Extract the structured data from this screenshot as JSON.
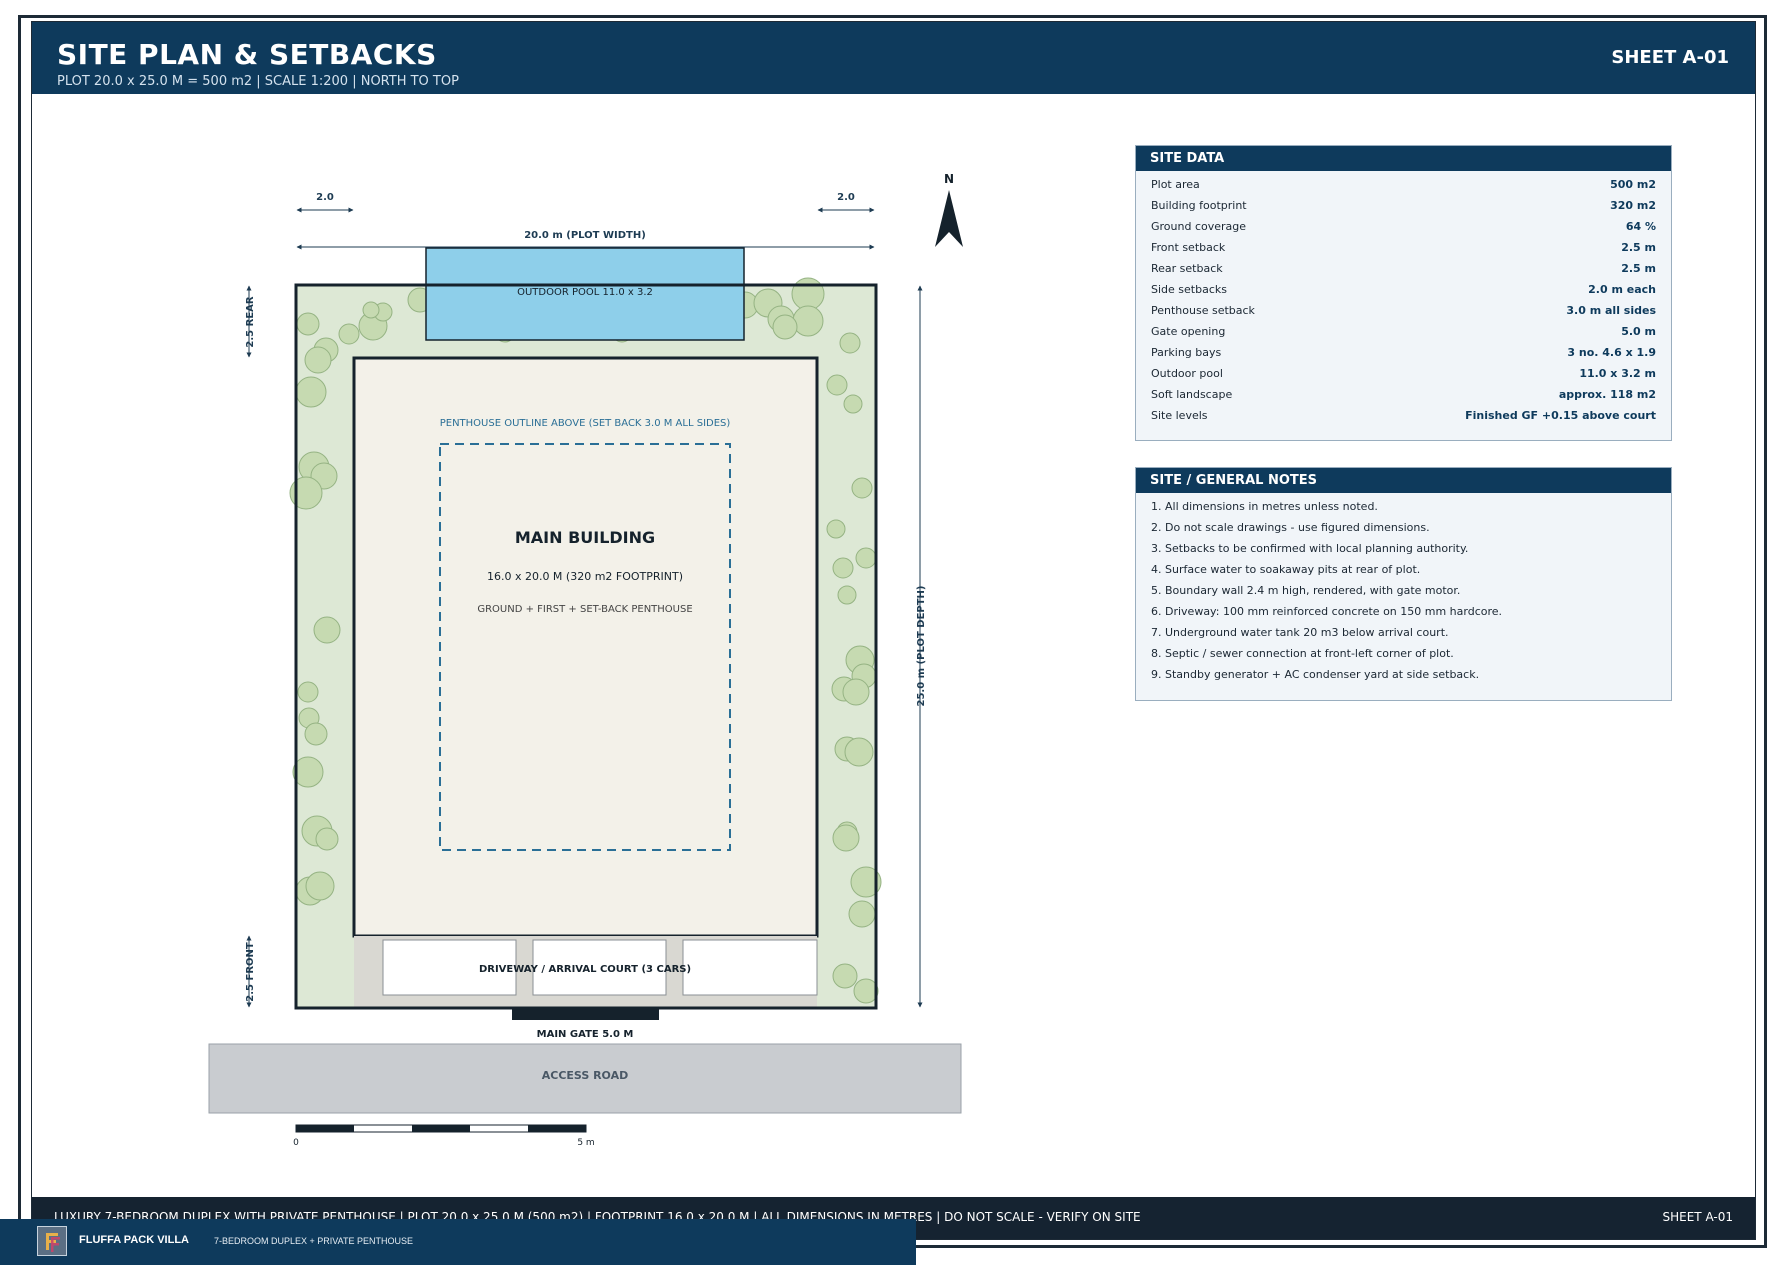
{
  "header": {
    "title": "SITE PLAN & SETBACKS",
    "subtitle": "PLOT 20.0 x 25.0 M = 500 m2  |  SCALE 1:200  |  NORTH TO TOP",
    "sheet": "SHEET A-01"
  },
  "plan": {
    "north": "N",
    "left_dim": "2.0",
    "right_dim": "2.0",
    "plot_width": "20.0 m  (PLOT WIDTH)",
    "plot_depth": "25.0 m  (PLOT DEPTH)",
    "rear_setback": "2.5 REAR",
    "front_setback": "2.5 FRONT",
    "pool_label": "OUTDOOR POOL 11.0 x 3.2",
    "penthouse_note": "PENTHOUSE OUTLINE ABOVE (SET BACK 3.0 M ALL SIDES)",
    "building_title": "MAIN BUILDING",
    "building_dims": "16.0 x 20.0 M  (320 m2 FOOTPRINT)",
    "building_levels": "GROUND + FIRST + SET-BACK PENTHOUSE",
    "driveway_label": "DRIVEWAY / ARRIVAL COURT  (3 CARS)",
    "gate_label": "MAIN GATE 5.0 M",
    "road_label": "ACCESS ROAD",
    "scale_start": "0",
    "scale_end": "5 m"
  },
  "site_data": {
    "title": "SITE DATA",
    "rows": [
      {
        "label": "Plot area",
        "value": "500 m2"
      },
      {
        "label": "Building footprint",
        "value": "320 m2"
      },
      {
        "label": "Ground coverage",
        "value": "64 %"
      },
      {
        "label": "Front setback",
        "value": "2.5 m"
      },
      {
        "label": "Rear setback",
        "value": "2.5 m"
      },
      {
        "label": "Side setbacks",
        "value": "2.0 m each"
      },
      {
        "label": "Penthouse setback",
        "value": "3.0 m all sides"
      },
      {
        "label": "Gate opening",
        "value": "5.0 m"
      },
      {
        "label": "Parking bays",
        "value": "3 no. 4.6 x 1.9"
      },
      {
        "label": "Outdoor pool",
        "value": "11.0 x 3.2 m"
      },
      {
        "label": "Soft landscape",
        "value": "approx. 118 m2"
      },
      {
        "label": "Site levels",
        "value": "Finished GF +0.15 above court"
      }
    ]
  },
  "notes": {
    "title": "SITE / GENERAL NOTES",
    "items": [
      "1.  All dimensions in metres unless noted.",
      "2.  Do not scale drawings - use figured dimensions.",
      "3.  Setbacks to be confirmed with local planning authority.",
      "4.  Surface water to soakaway pits at rear of plot.",
      "5.  Boundary wall 2.4 m high, rendered, with gate motor.",
      "6.  Driveway: 100 mm reinforced concrete on 150 mm hardcore.",
      "7.  Underground water tank 20 m3 below arrival court.",
      "8.  Septic / sewer connection at front-left corner of plot.",
      "9.  Standby generator + AC condenser yard at side setback."
    ]
  },
  "footer": {
    "text": "LUXURY 7-BEDROOM DUPLEX WITH PRIVATE PENTHOUSE   |   PLOT 20.0 x 25.0 M (500 m2)   |   FOOTPRINT 16.0 x 20.0 M   |   ALL DIMENSIONS IN METRES   |   DO NOT SCALE - VERIFY ON SITE",
    "sheet": "SHEET A-01"
  },
  "brand": {
    "name": "FLUFFA PACK VILLA",
    "tagline": "7-BEDROOM DUPLEX + PRIVATE PENTHOUSE",
    "logo_icon": "ff-monogram-icon"
  },
  "colors": {
    "navy": "#0e3a5c",
    "landscape": "#dde8d5",
    "building": "#f3f1e9",
    "pool": "#8ecfea",
    "penthouse_dash": "#2a6f96",
    "road": "#c9ccd0"
  }
}
